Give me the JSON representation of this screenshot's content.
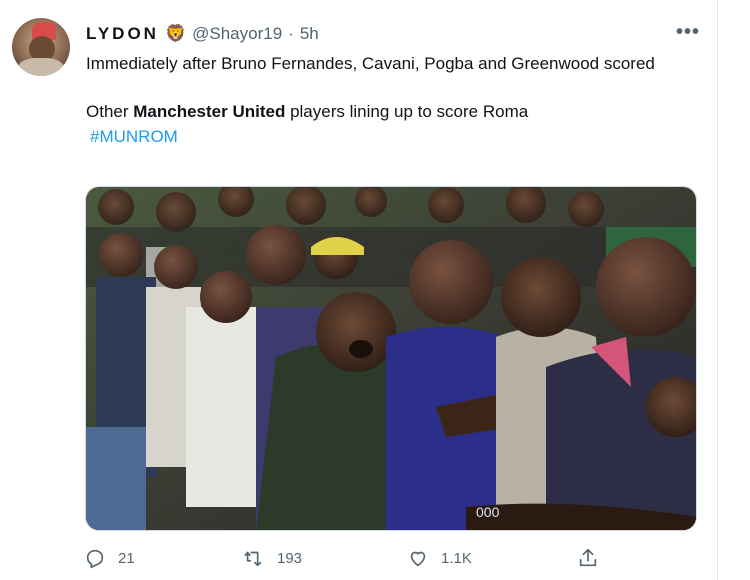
{
  "user": {
    "display_name": "LYDON",
    "badge_emoji": "🦁",
    "handle": "@Shayor19",
    "separator": "·",
    "time": "5h"
  },
  "more_button": "•••",
  "tweet": {
    "line1": "Immediately after Bruno Fernandes, Cavani, Pogba and Greenwood scored",
    "line2_prefix": "Other ",
    "line2_bold": "Manchester United",
    "line2_suffix": " players lining up to score Roma",
    "hashtag": "#MUNROM"
  },
  "media": {
    "description_icon": "photo",
    "jersey_text": "000"
  },
  "actions": {
    "reply_count": "21",
    "retweet_count": "193",
    "like_count": "1.1K"
  },
  "colors": {
    "link": "#1d9bf0",
    "muted": "#536471",
    "text": "#0f1419"
  }
}
